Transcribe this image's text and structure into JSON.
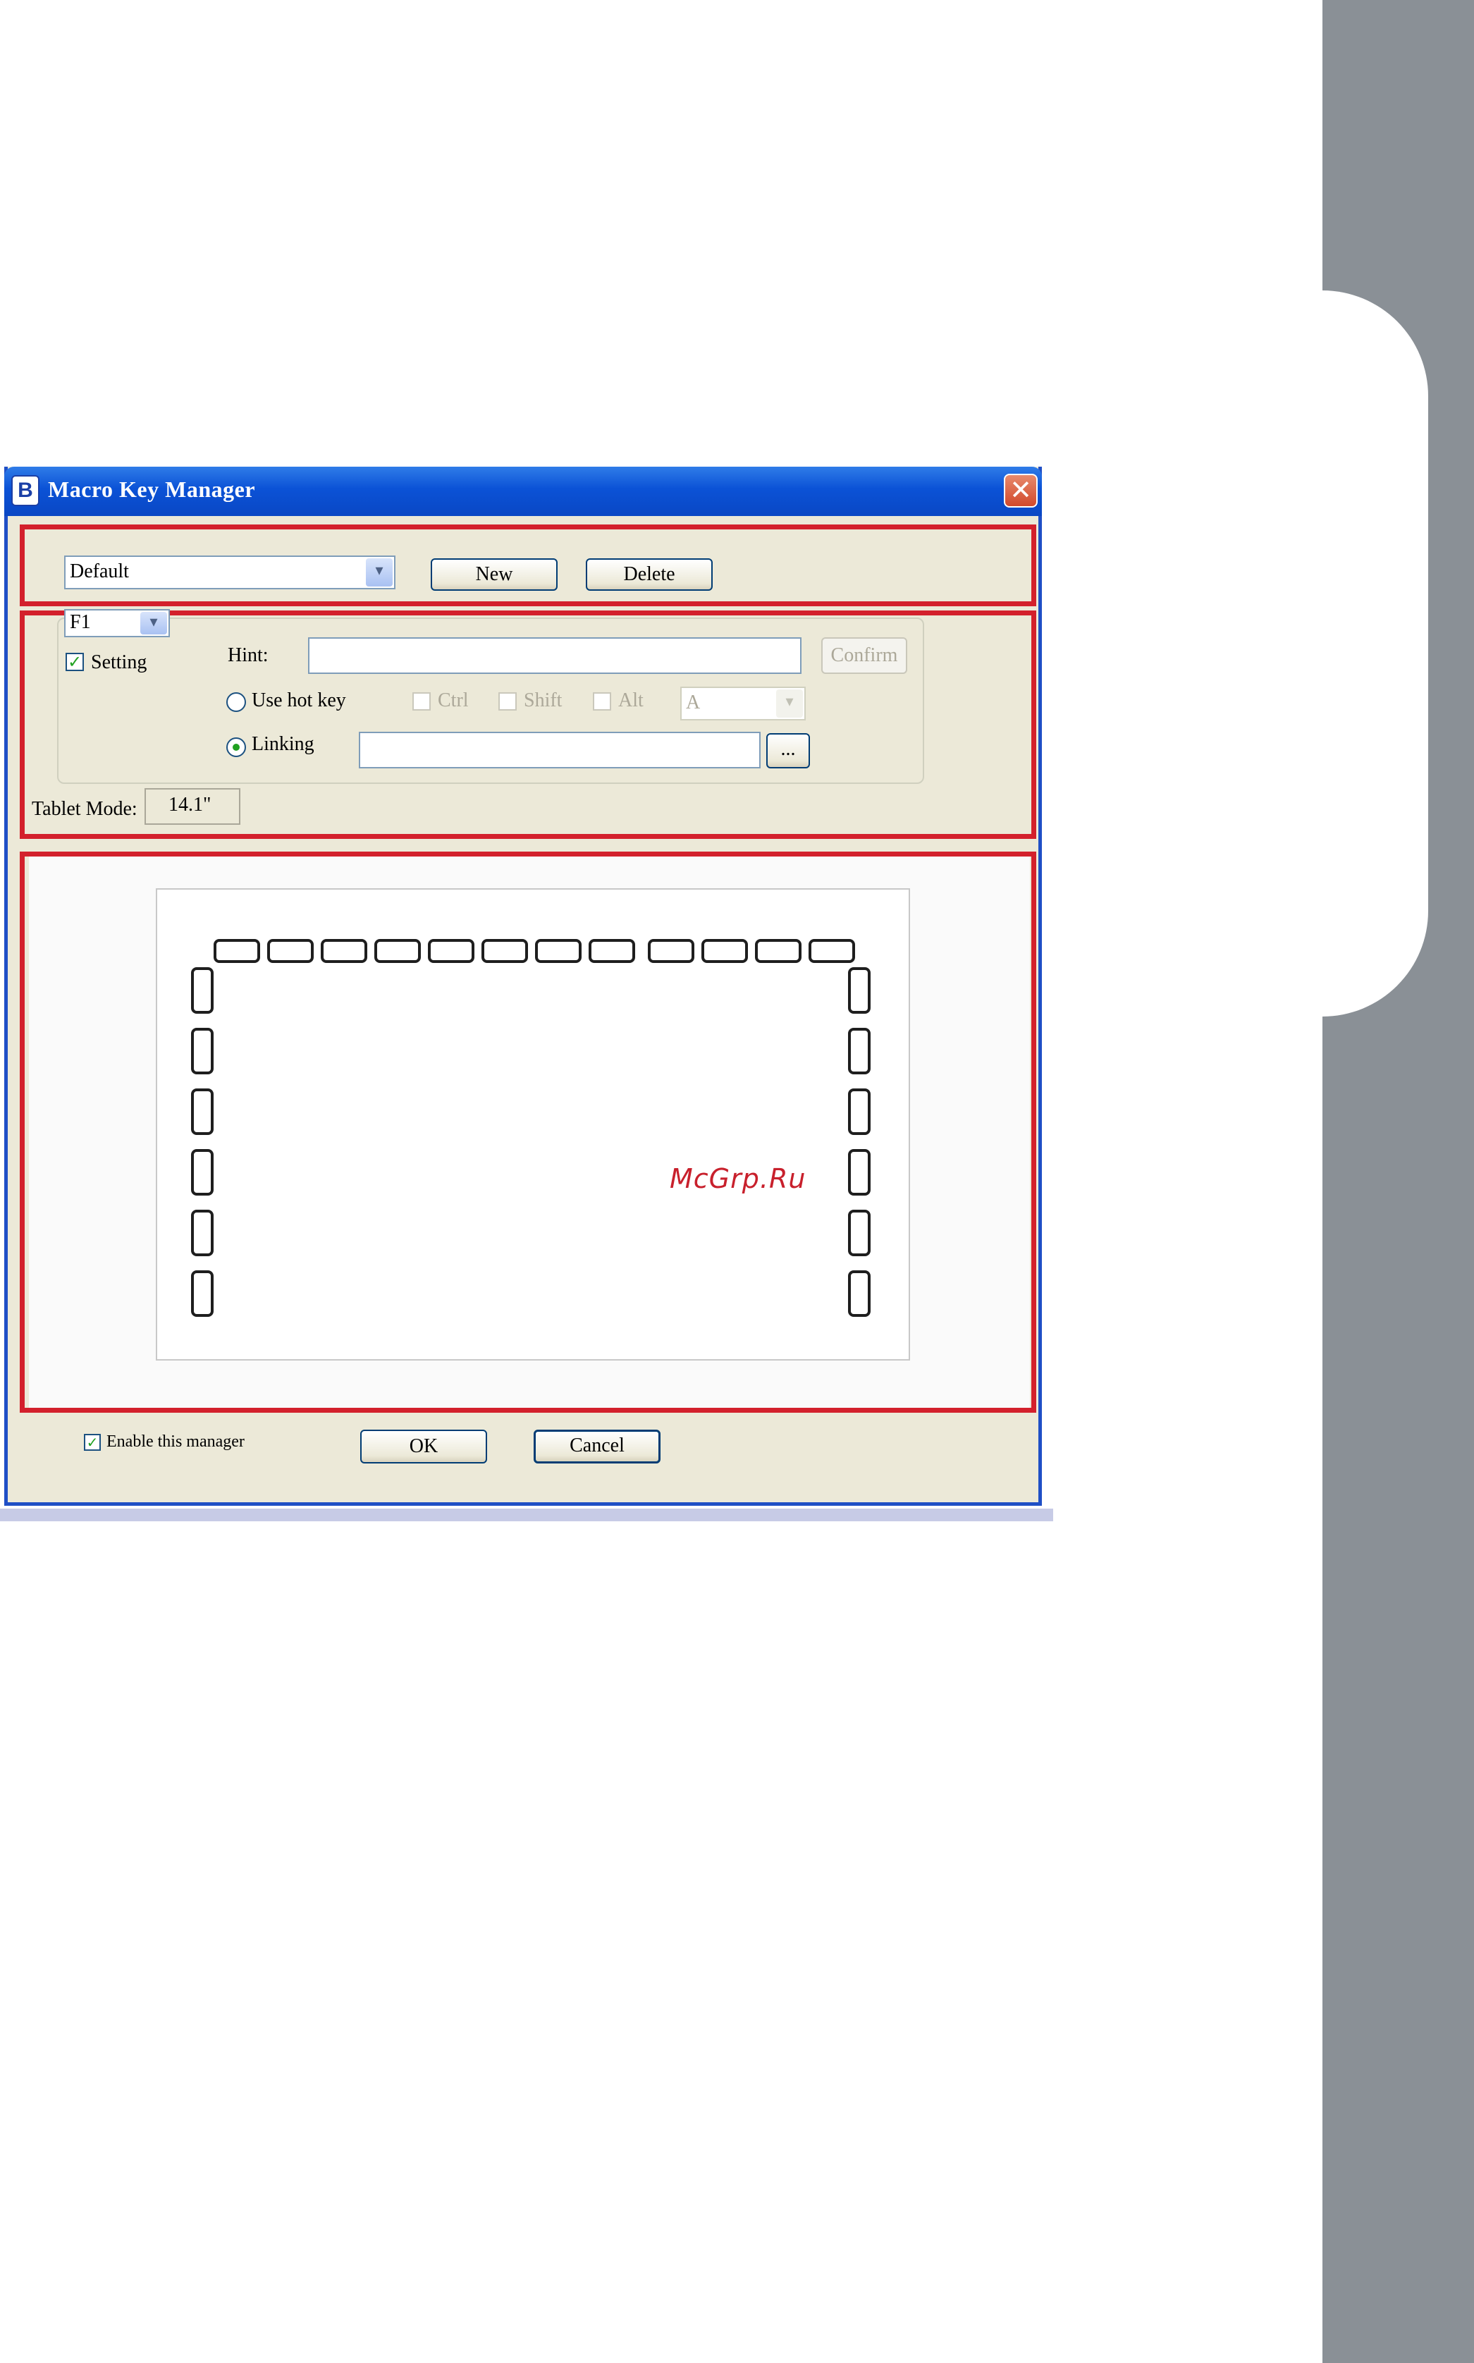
{
  "window": {
    "title": "Macro Key Manager",
    "app_icon_glyph": "B",
    "close_glyph": "✕"
  },
  "profile": {
    "selected": "Default",
    "new_label": "New",
    "delete_label": "Delete"
  },
  "key_settings": {
    "key_selected": "F1",
    "setting_label": "Setting",
    "setting_checked": true,
    "hint_label": "Hint:",
    "hint_value": "",
    "confirm_label": "Confirm",
    "use_hot_key_label": "Use hot key",
    "ctrl_label": "Ctrl",
    "shift_label": "Shift",
    "alt_label": "Alt",
    "hot_key_letter": "A",
    "linking_label": "Linking",
    "linking_value": "",
    "browse_label": "...",
    "mode": "Linking"
  },
  "tablet_mode": {
    "label": "Tablet Mode:",
    "value": "14.1\""
  },
  "preview": {
    "top_keys": 12,
    "left_keys": 6,
    "right_keys": 6
  },
  "footer": {
    "enable_label": "Enable this manager",
    "enable_checked": true,
    "ok_label": "OK",
    "cancel_label": "Cancel"
  },
  "watermark": "McGrp.Ru",
  "colors": {
    "highlight_red": "#d3202c",
    "titlebar_blue": "#0b52d6",
    "dialog_bg": "#ece9d8",
    "side_band": "#8a9096"
  }
}
